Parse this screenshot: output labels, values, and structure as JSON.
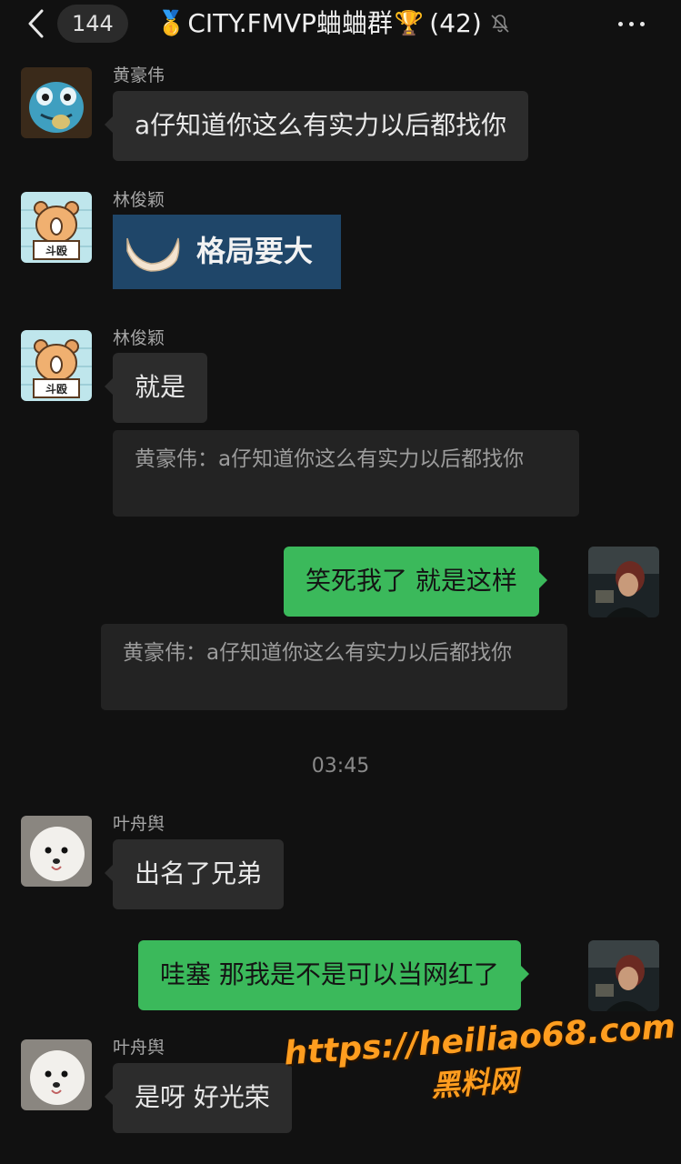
{
  "header": {
    "unread_count": "144",
    "title": "CITY.FMVP蛐蛐群",
    "member_count": "(42)",
    "icons": [
      "back-chevron-icon",
      "medal-icon",
      "trophy-icon",
      "mute-bell-icon",
      "more-dots-icon"
    ]
  },
  "messages": [
    {
      "sender": "黄豪伟",
      "text": "a仔知道你这么有实力以后都找你"
    },
    {
      "sender": "林俊颖",
      "sticker_text": "格局要大"
    },
    {
      "sender": "林俊颖",
      "text": "就是",
      "quote": "黄豪伟：a仔知道你这么有实力以后都找你"
    },
    {
      "text": "笑死我了 就是这样",
      "quote": "黄豪伟：a仔知道你这么有实力以后都找你"
    },
    {
      "sender": "叶舟舆",
      "text": "出名了兄弟"
    },
    {
      "text": "哇塞 那我是不是可以当网红了"
    },
    {
      "sender": "叶舟舆",
      "text": "是呀 好光荣"
    }
  ],
  "timestamp": "03:45",
  "avatars": {
    "m0": "monster-avatar",
    "m1": "bear-doudou-avatar",
    "m4": "white-dog-avatar",
    "self": "self-photo-avatar"
  },
  "bear_sign_text": "斗殴",
  "watermark": {
    "url": "https://heiliao68.com",
    "name": "黑料网"
  },
  "colors": {
    "background": "#111111",
    "incoming_bubble": "#2c2c2c",
    "outgoing_bubble": "#3bb95b",
    "watermark": "#ff9d1f"
  }
}
